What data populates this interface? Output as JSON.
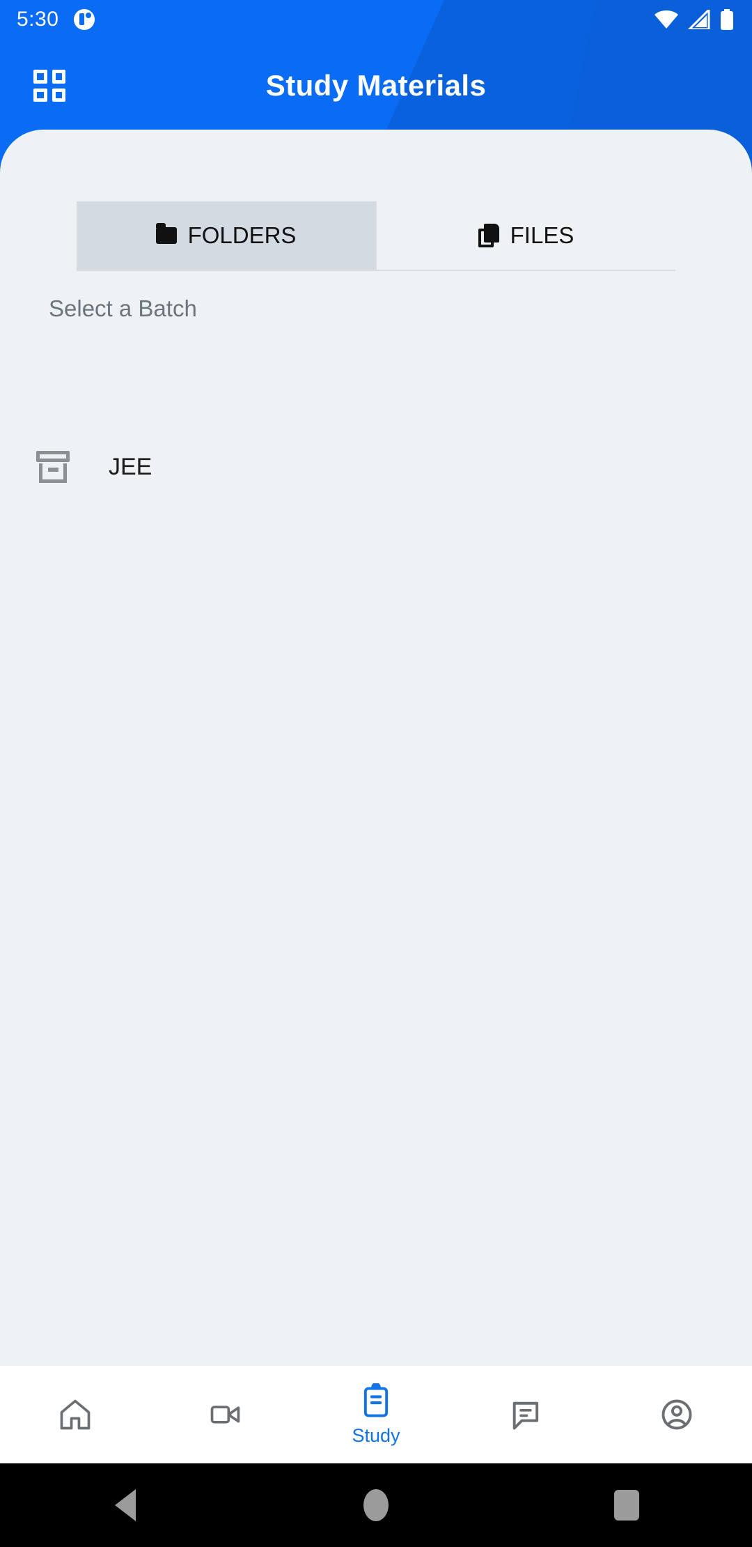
{
  "status_bar": {
    "time": "5:30",
    "notification_icon": "app-notification-icon",
    "wifi_icon": "wifi-icon",
    "signal_icon": "cellular-signal-icon",
    "battery_icon": "battery-full-icon"
  },
  "app_bar": {
    "menu_icon": "grid-menu-icon",
    "title": "Study Materials"
  },
  "tabs": [
    {
      "label": "FOLDERS",
      "icon": "folder-icon",
      "active": true
    },
    {
      "label": "FILES",
      "icon": "files-icon",
      "active": false
    }
  ],
  "content": {
    "section_label": "Select a Batch",
    "batches": [
      {
        "name": "JEE",
        "icon": "archive-box-icon"
      }
    ]
  },
  "bottom_nav": [
    {
      "label": "",
      "icon": "home-icon",
      "active": false
    },
    {
      "label": "",
      "icon": "video-camera-icon",
      "active": false
    },
    {
      "label": "Study",
      "icon": "clipboard-icon",
      "active": true
    },
    {
      "label": "",
      "icon": "chat-bubble-icon",
      "active": false
    },
    {
      "label": "",
      "icon": "account-circle-icon",
      "active": false
    }
  ],
  "system_nav": {
    "back": "back-triangle-icon",
    "home": "home-circle-icon",
    "recents": "recents-square-icon"
  },
  "colors": {
    "primary": "#0a6cf5",
    "primary_dark": "#0b5fd8",
    "surface": "#eff2f5",
    "tab_active": "#d3dae2",
    "accent": "#1173e6",
    "muted_text": "#6c757d"
  }
}
